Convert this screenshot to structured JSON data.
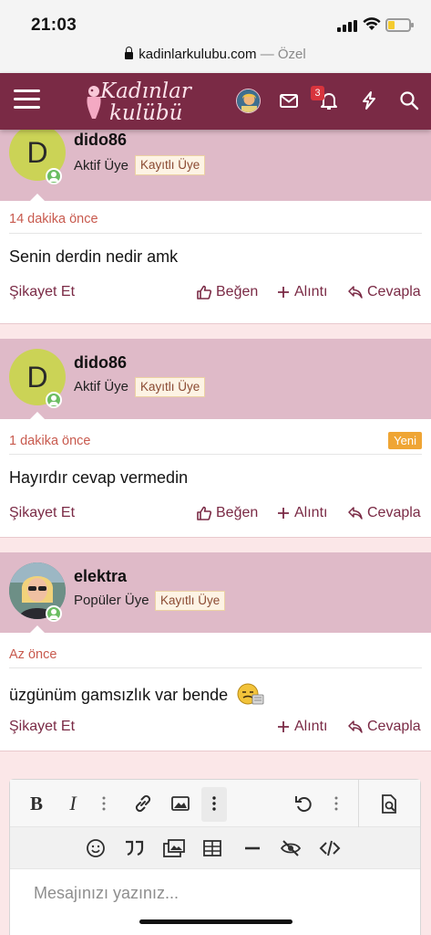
{
  "status_bar": {
    "time": "21:03",
    "battery_level": 0.3,
    "battery_color": "#f4cb2f"
  },
  "url_bar": {
    "domain": "kadinlarkulubu.com",
    "separator": "—",
    "label": "Özel"
  },
  "nav": {
    "logo_line1": "Kadınlar",
    "logo_line2": "kulübü",
    "notification_count": "3",
    "bar_color": "#7a2a45",
    "icons": [
      "menu-icon",
      "avatar",
      "mail-icon",
      "bell-icon",
      "bolt-icon",
      "search-icon"
    ]
  },
  "posts": [
    {
      "avatar_letter": "D",
      "username": "dido86",
      "role": "Aktif Üye",
      "registered_badge": "Kayıtlı Üye",
      "date": "14 dakika önce",
      "message": "Senin derdin nedir amk",
      "report_label": "Şikayet Et",
      "like_label": "Beğen",
      "quote_label": "Alıntı",
      "reply_label": "Cevapla"
    },
    {
      "avatar_letter": "D",
      "username": "dido86",
      "role": "Aktif Üye",
      "registered_badge": "Kayıtlı Üye",
      "date": "1 dakika önce",
      "new_tag": "Yeni",
      "message": "Hayırdır cevap vermedin",
      "report_label": "Şikayet Et",
      "like_label": "Beğen",
      "quote_label": "Alıntı",
      "reply_label": "Cevapla"
    },
    {
      "username": "elektra",
      "role": "Popüler Üye",
      "registered_badge": "Kayıtlı Üye",
      "date": "Az önce",
      "message": "üzgünüm gamsızlık var bende",
      "report_label": "Şikayet Et",
      "quote_label": "Alıntı",
      "reply_label": "Cevapla"
    }
  ],
  "editor": {
    "placeholder": "Mesajınızı yazınız...",
    "toolbar_row1": [
      "bold-icon",
      "italic-icon",
      "more-options-icon",
      "link-icon",
      "image-icon",
      "more-options-icon",
      "undo-icon",
      "more-options-icon",
      "preview-icon"
    ],
    "toolbar_row2": [
      "smiley-icon",
      "quote-icon",
      "media-icon",
      "table-icon",
      "horizontal-rule-icon",
      "spoiler-icon",
      "code-icon"
    ]
  }
}
